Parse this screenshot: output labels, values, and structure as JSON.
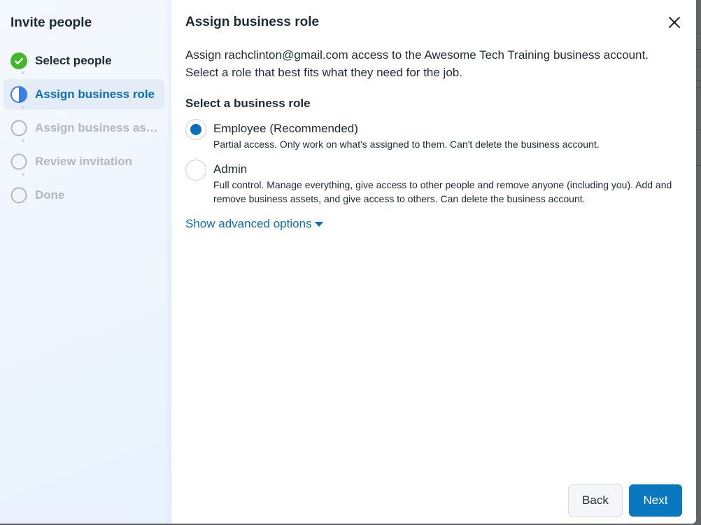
{
  "sidebar": {
    "title": "Invite people",
    "steps": [
      {
        "label": "Select people",
        "status": "done",
        "icon": "check-circle-icon"
      },
      {
        "label": "Assign business role",
        "status": "active",
        "icon": "half-circle-icon"
      },
      {
        "label": "Assign business assets",
        "status": "pending",
        "icon": "empty-circle-icon"
      },
      {
        "label": "Review invitation",
        "status": "pending",
        "icon": "empty-circle-icon"
      },
      {
        "label": "Done",
        "status": "pending",
        "icon": "empty-circle-icon"
      }
    ]
  },
  "main": {
    "title": "Assign business role",
    "description_line1": "Assign rachclinton@gmail.com access to the Awesome Tech Training business account.",
    "description_line2": "Select a role that best fits what they need for the job.",
    "section_label": "Select a business role",
    "roles": [
      {
        "title": "Employee (Recommended)",
        "description": "Partial access. Only work on what's assigned to them. Can't delete the business account.",
        "selected": true
      },
      {
        "title": "Admin",
        "description": "Full control. Manage everything, give access to other people and remove anyone (including you). Add and remove business assets, and give access to others. Can delete the business account.",
        "selected": false
      }
    ],
    "advanced_link": "Show advanced options"
  },
  "footer": {
    "back_label": "Back",
    "next_label": "Next"
  },
  "colors": {
    "accent": "#0a78be",
    "link": "#0a6fb8",
    "success": "#42b72a",
    "text": "#1c2b33",
    "disabled": "#b4b8bc"
  }
}
